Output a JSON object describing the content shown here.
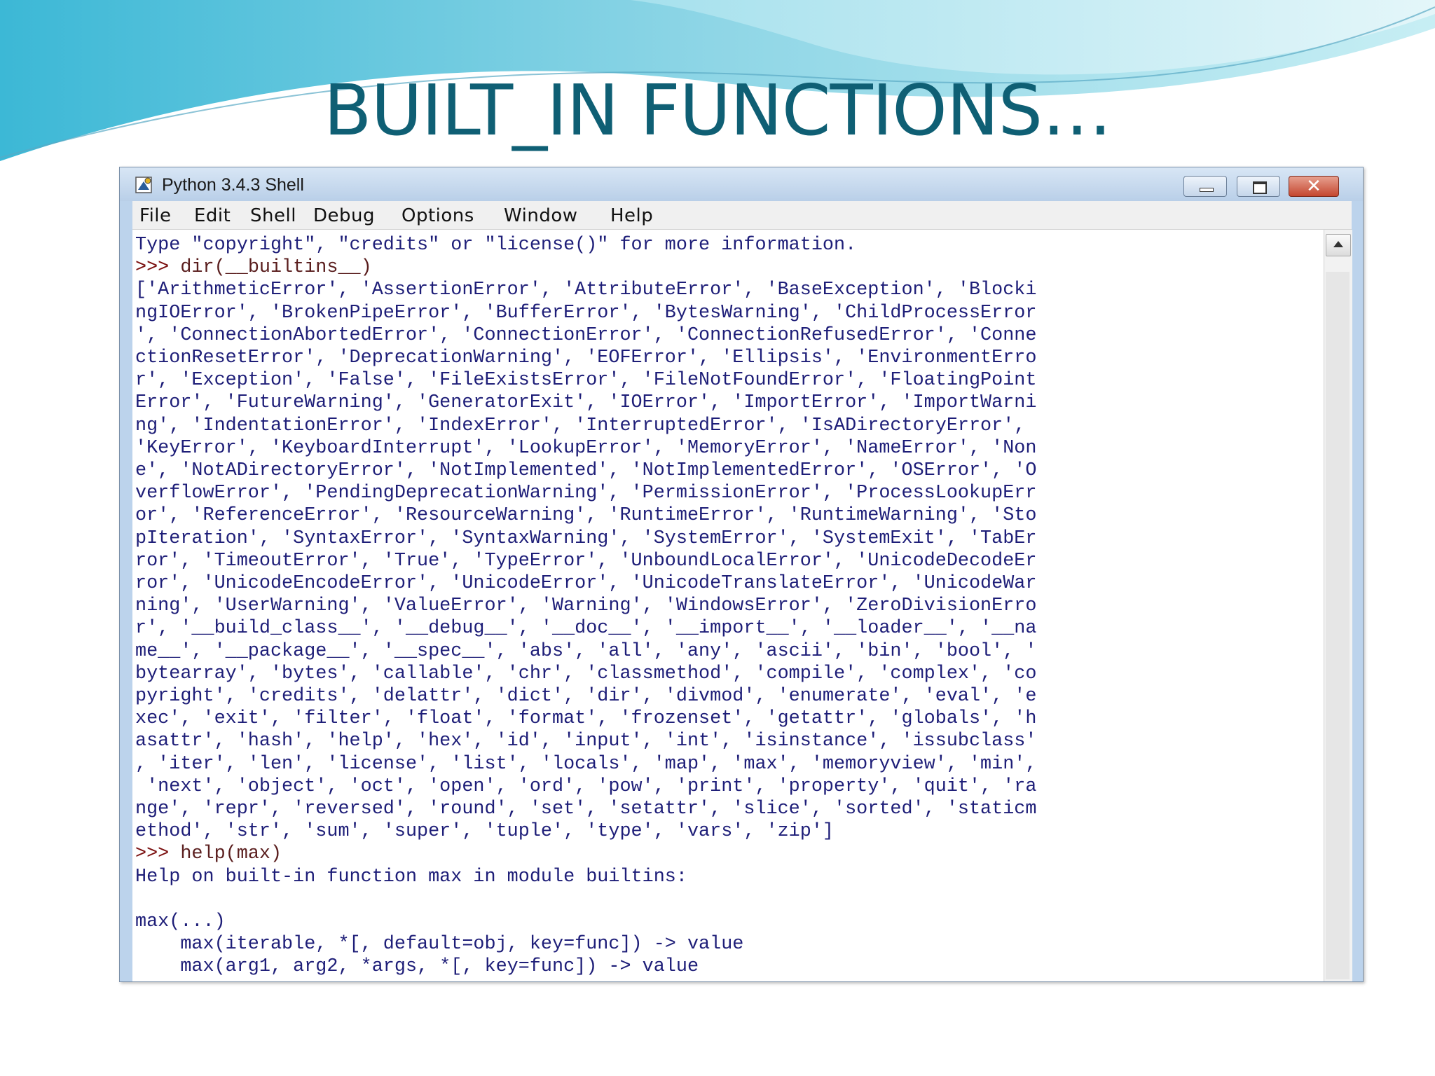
{
  "slide": {
    "title": "BUILT_IN FUNCTIONS…",
    "accent_color": "#0f5f74"
  },
  "window": {
    "title": "Python 3.4.3 Shell",
    "app_icon": "python-shell-icon",
    "buttons": {
      "minimize_icon": "minimize-icon",
      "restore_icon": "restore-icon",
      "close_icon": "close-icon",
      "close_glyph": "✕"
    }
  },
  "menu": {
    "items": [
      "File",
      "Edit",
      "Shell",
      "Debug",
      "Options",
      "Window",
      "Help"
    ]
  },
  "shell": {
    "lines": [
      {
        "type": "output",
        "text": "Type \"copyright\", \"credits\" or \"license()\" for more information."
      },
      {
        "type": "prompt",
        "prompt": ">>> ",
        "text": "dir(__builtins__)"
      },
      {
        "type": "output",
        "text": "['ArithmeticError', 'AssertionError', 'AttributeError', 'BaseException', 'Blocki"
      },
      {
        "type": "output",
        "text": "ngIOError', 'BrokenPipeError', 'BufferError', 'BytesWarning', 'ChildProcessError"
      },
      {
        "type": "output",
        "text": "', 'ConnectionAbortedError', 'ConnectionError', 'ConnectionRefusedError', 'Conne"
      },
      {
        "type": "output",
        "text": "ctionResetError', 'DeprecationWarning', 'EOFError', 'Ellipsis', 'EnvironmentErro"
      },
      {
        "type": "output",
        "text": "r', 'Exception', 'False', 'FileExistsError', 'FileNotFoundError', 'FloatingPoint"
      },
      {
        "type": "output",
        "text": "Error', 'FutureWarning', 'GeneratorExit', 'IOError', 'ImportError', 'ImportWarni"
      },
      {
        "type": "output",
        "text": "ng', 'IndentationError', 'IndexError', 'InterruptedError', 'IsADirectoryError',"
      },
      {
        "type": "output",
        "text": "'KeyError', 'KeyboardInterrupt', 'LookupError', 'MemoryError', 'NameError', 'Non"
      },
      {
        "type": "output",
        "text": "e', 'NotADirectoryError', 'NotImplemented', 'NotImplementedError', 'OSError', 'O"
      },
      {
        "type": "output",
        "text": "verflowError', 'PendingDeprecationWarning', 'PermissionError', 'ProcessLookupErr"
      },
      {
        "type": "output",
        "text": "or', 'ReferenceError', 'ResourceWarning', 'RuntimeError', 'RuntimeWarning', 'Sto"
      },
      {
        "type": "output",
        "text": "pIteration', 'SyntaxError', 'SyntaxWarning', 'SystemError', 'SystemExit', 'TabEr"
      },
      {
        "type": "output",
        "text": "ror', 'TimeoutError', 'True', 'TypeError', 'UnboundLocalError', 'UnicodeDecodeEr"
      },
      {
        "type": "output",
        "text": "ror', 'UnicodeEncodeError', 'UnicodeError', 'UnicodeTranslateError', 'UnicodeWar"
      },
      {
        "type": "output",
        "text": "ning', 'UserWarning', 'ValueError', 'Warning', 'WindowsError', 'ZeroDivisionErro"
      },
      {
        "type": "output",
        "text": "r', '__build_class__', '__debug__', '__doc__', '__import__', '__loader__', '__na"
      },
      {
        "type": "output",
        "text": "me__', '__package__', '__spec__', 'abs', 'all', 'any', 'ascii', 'bin', 'bool', '"
      },
      {
        "type": "output",
        "text": "bytearray', 'bytes', 'callable', 'chr', 'classmethod', 'compile', 'complex', 'co"
      },
      {
        "type": "output",
        "text": "pyright', 'credits', 'delattr', 'dict', 'dir', 'divmod', 'enumerate', 'eval', 'e"
      },
      {
        "type": "output",
        "text": "xec', 'exit', 'filter', 'float', 'format', 'frozenset', 'getattr', 'globals', 'h"
      },
      {
        "type": "output",
        "text": "asattr', 'hash', 'help', 'hex', 'id', 'input', 'int', 'isinstance', 'issubclass'"
      },
      {
        "type": "output",
        "text": ", 'iter', 'len', 'license', 'list', 'locals', 'map', 'max', 'memoryview', 'min',"
      },
      {
        "type": "output",
        "text": " 'next', 'object', 'oct', 'open', 'ord', 'pow', 'print', 'property', 'quit', 'ra"
      },
      {
        "type": "output",
        "text": "nge', 'repr', 'reversed', 'round', 'set', 'setattr', 'slice', 'sorted', 'staticm"
      },
      {
        "type": "output",
        "text": "ethod', 'str', 'sum', 'super', 'tuple', 'type', 'vars', 'zip']"
      },
      {
        "type": "prompt",
        "prompt": ">>> ",
        "text": "help(max)"
      },
      {
        "type": "output",
        "text": "Help on built-in function max in module builtins:"
      },
      {
        "type": "output",
        "text": ""
      },
      {
        "type": "output",
        "text": "max(...)"
      },
      {
        "type": "output",
        "text": "    max(iterable, *[, default=obj, key=func]) -> value"
      },
      {
        "type": "output",
        "text": "    max(arg1, arg2, *args, *[, key=func]) -> value"
      }
    ]
  },
  "scrollbar": {
    "up_icon": "scroll-up-arrow-icon"
  }
}
